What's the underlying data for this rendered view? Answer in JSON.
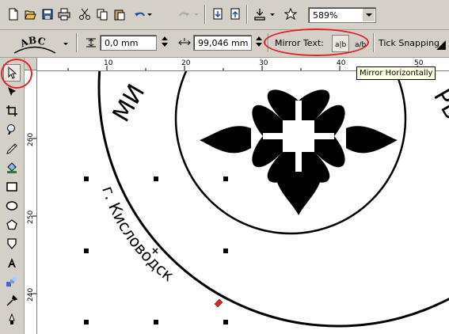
{
  "toolbar": {
    "zoom_value": "589%",
    "buttons": [
      "new-icon",
      "open-icon",
      "save-icon",
      "print-icon",
      "cut-icon",
      "copy-icon",
      "paste-icon",
      "undo-icon",
      "redo-icon",
      "import-icon",
      "export-icon",
      "app-launcher-icon",
      "welcome-icon"
    ]
  },
  "property_bar": {
    "text_preset_label": "ABC",
    "position_value": "0,0 mm",
    "distance_value": "99,046 mm",
    "mirror_text_label": "Mirror Text:",
    "mirror_horizontal_glyph": "a|b",
    "mirror_vertical_glyph": "a/b",
    "tick_snapping_label": "Tick Snapping"
  },
  "tooltip": {
    "text": "Mirror Horizontally"
  },
  "ruler": {
    "horizontal_ticks": [
      "10",
      "20",
      "30",
      "40",
      "50"
    ],
    "vertical_ticks": [
      "260",
      "250",
      "240"
    ]
  },
  "canvas": {
    "arc_text_top_left": "МИ",
    "arc_text_top_right": "РЬ",
    "arc_text_along_circle": "г. Кисловодск",
    "colors": {
      "ink": "#000000",
      "highlight": "#e0202a"
    }
  },
  "tools": [
    "pick-tool-icon",
    "shape-tool-icon",
    "crop-tool-icon",
    "zoom-tool-icon",
    "freehand-tool-icon",
    "smart-fill-icon",
    "rectangle-tool-icon",
    "ellipse-tool-icon",
    "polygon-tool-icon",
    "basic-shapes-icon",
    "text-tool-icon",
    "interactive-blend-icon",
    "eyedropper-icon",
    "outline-tool-icon"
  ]
}
